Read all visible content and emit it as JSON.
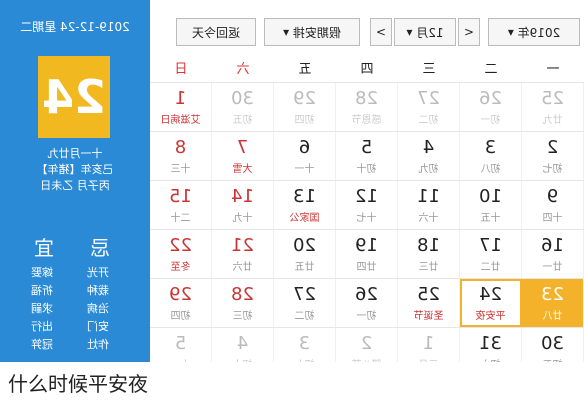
{
  "left_panel": {
    "date_top": "2019-12-24 星期二",
    "big_day": "24",
    "lunar_lines": [
      "十一月廿九",
      "己亥年【猪年】",
      "丙子月 乙未日"
    ],
    "yi_title": "宜",
    "ji_title": "忌",
    "yi_items": [
      "嫁娶",
      "祈福",
      "求嗣",
      "出行",
      "冠笄"
    ],
    "ji_items": [
      "开光",
      "栽种",
      "治病",
      "安门",
      "作灶"
    ]
  },
  "toolbar": {
    "year": "2019年",
    "prev": "<",
    "month": "12月",
    "next": ">",
    "holiday": "假期安排",
    "back_today": "返回今天"
  },
  "weekdays": [
    "一",
    "二",
    "三",
    "四",
    "五",
    "六",
    "日"
  ],
  "rows": [
    [
      {
        "d": "25",
        "s": "廿九",
        "c": "gray"
      },
      {
        "d": "26",
        "s": "初一",
        "c": "gray"
      },
      {
        "d": "27",
        "s": "初二",
        "c": "gray"
      },
      {
        "d": "28",
        "s": "感恩节",
        "c": "gray"
      },
      {
        "d": "29",
        "s": "初四",
        "c": "gray"
      },
      {
        "d": "30",
        "s": "初五",
        "c": "gray"
      },
      {
        "d": "1",
        "s": "艾滋病日",
        "c": "wkd red"
      }
    ],
    [
      {
        "d": "2",
        "s": "初七",
        "c": ""
      },
      {
        "d": "3",
        "s": "初八",
        "c": ""
      },
      {
        "d": "4",
        "s": "初九",
        "c": ""
      },
      {
        "d": "5",
        "s": "初十",
        "c": ""
      },
      {
        "d": "6",
        "s": "十一",
        "c": ""
      },
      {
        "d": "7",
        "s": "大雪",
        "c": "wkd red"
      },
      {
        "d": "8",
        "s": "十三",
        "c": "wkd"
      }
    ],
    [
      {
        "d": "9",
        "s": "十四",
        "c": ""
      },
      {
        "d": "10",
        "s": "十五",
        "c": ""
      },
      {
        "d": "11",
        "s": "十六",
        "c": ""
      },
      {
        "d": "12",
        "s": "十七",
        "c": ""
      },
      {
        "d": "13",
        "s": "国家公",
        "c": "red"
      },
      {
        "d": "14",
        "s": "十九",
        "c": "wkd"
      },
      {
        "d": "15",
        "s": "二十",
        "c": "wkd"
      }
    ],
    [
      {
        "d": "16",
        "s": "廿一",
        "c": ""
      },
      {
        "d": "17",
        "s": "廿二",
        "c": ""
      },
      {
        "d": "18",
        "s": "廿三",
        "c": ""
      },
      {
        "d": "19",
        "s": "廿四",
        "c": ""
      },
      {
        "d": "20",
        "s": "廿五",
        "c": ""
      },
      {
        "d": "21",
        "s": "廿六",
        "c": "wkd"
      },
      {
        "d": "22",
        "s": "冬至",
        "c": "wkd red"
      }
    ],
    [
      {
        "d": "23",
        "s": "廿八",
        "c": "sel"
      },
      {
        "d": "24",
        "s": "平安夜",
        "c": "today red"
      },
      {
        "d": "25",
        "s": "圣诞节",
        "c": "red"
      },
      {
        "d": "26",
        "s": "初一",
        "c": ""
      },
      {
        "d": "27",
        "s": "初二",
        "c": ""
      },
      {
        "d": "28",
        "s": "初三",
        "c": "wkd"
      },
      {
        "d": "29",
        "s": "初四",
        "c": "wkd"
      }
    ],
    [
      {
        "d": "30",
        "s": "初五",
        "c": ""
      },
      {
        "d": "31",
        "s": "初六",
        "c": ""
      },
      {
        "d": "1",
        "s": "元旦",
        "c": "gray"
      },
      {
        "d": "2",
        "s": "腊八节",
        "c": "gray"
      },
      {
        "d": "3",
        "s": "初九",
        "c": "gray"
      },
      {
        "d": "4",
        "s": "初十",
        "c": "gray"
      },
      {
        "d": "5",
        "s": "十一",
        "c": "gray"
      }
    ]
  ],
  "caption": "什么时候平安夜"
}
